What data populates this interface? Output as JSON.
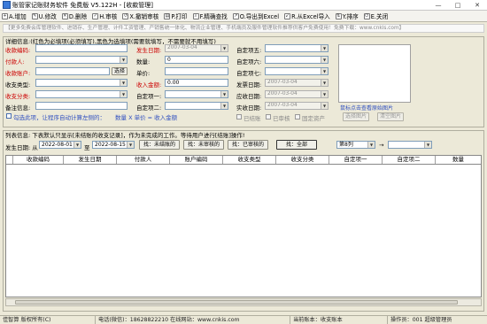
{
  "window": {
    "title": "账管家记账财务软件 免费版  V5.122H - [收款管理]",
    "controls": [
      "—",
      "□",
      "✕"
    ]
  },
  "toolbar": {
    "items": [
      {
        "label": "A.增加",
        "icon": "add-icon"
      },
      {
        "label": "U.修改",
        "icon": "edit-icon"
      },
      {
        "label": "D.删除",
        "icon": "delete-icon"
      },
      {
        "label": "H.审核",
        "icon": "approve-icon"
      },
      {
        "label": "X.撤销审核",
        "icon": "undo-approve-icon"
      },
      {
        "label": "P.打印",
        "icon": "print-icon"
      },
      {
        "label": "F.精确查找",
        "icon": "find-icon"
      },
      {
        "label": "O.导出到Excel",
        "icon": "export-excel-icon"
      },
      {
        "label": "R.从Excel导入",
        "icon": "import-excel-icon"
      },
      {
        "label": "Y.排序",
        "icon": "sort-icon"
      },
      {
        "label": "E.关闭",
        "icon": "close-icon"
      }
    ]
  },
  "notice": "【更多免费会库管理软件、进销存、生产管理、计件工资管理、产销售统一体化、物流企业管理、手机端员及服件管理软件推荐供客户免费使用！免费下载：www.cnkis.com】",
  "detail": {
    "legend": "详细信息:(红色为必填项(必须填写),黑色为选填项(需要就填写，不需要就不用填写)",
    "left_labels": {
      "receipt_no": "收款编码:",
      "payer": "付款人:",
      "account": "收款账户:",
      "type": "收支类型:",
      "category": "收支分类:",
      "remark": "备注信息:"
    },
    "select_button": "选择",
    "mid_labels": {
      "date": "发生日期:",
      "qty": "数量:",
      "unit_price": "单价:",
      "amount": "收入金额:",
      "custom1": "自定项一:",
      "custom2": "自定项二:"
    },
    "date_value": "2007-03-04",
    "qty_value": "0",
    "unit_price_value": "0.00",
    "amount_value": "0.00",
    "right_labels": {
      "custom5": "自定项五:",
      "custom6": "自定项六:",
      "custom7": "自定项七:",
      "invoice_date": "发票日期:",
      "due_date": "应收日期:",
      "actual_date": "实收日期:"
    },
    "invoice_date_value": "2007-03-04",
    "due_date_value": "2007-03-04",
    "actual_date_value": "2007-03-04",
    "auto_calc_checkbox": "勾选此项，让程序自动计算左侧的：",
    "auto_calc_formula": "数量 X 单价 = 收入金额",
    "status_checkboxes": [
      "已结账",
      "已审核",
      "固定资产"
    ],
    "image_link": "鼠标点击查看原始图片",
    "select_image_button": "选择图片",
    "clear_image_button": "清空图片"
  },
  "list": {
    "legend": "列表信息: 下表默认只显示[未结账的收支记录]，作为未完成的工作。等待用户进行[结账]操作!",
    "date_label": "发生日期: 从",
    "date_from": "2022-08-01",
    "date_to_label": "至",
    "date_to": "2022-08-15",
    "filter_buttons": [
      "找：未结账的",
      "找：未审核的",
      "找：已审核的",
      "找：全部"
    ],
    "column_select": "第8列",
    "search_value": "",
    "columns": [
      "收款编码",
      "发生日期",
      "付款人",
      "账户编码",
      "收支类型",
      "收支分类",
      "自定项一",
      "自定项二",
      "数量"
    ],
    "rows": []
  },
  "statusbar": {
    "company": "佳智算  版权所有(C)",
    "contact": "电话(微信)：18628822210  在线网站：www.cnkis.com",
    "account": "当前账本：收支账本",
    "operator": "操作员：001  超级管理员"
  },
  "colors": {
    "required_label": "#cc0000",
    "link": "#2f4fc0",
    "window_bg": "#ece9d8"
  }
}
